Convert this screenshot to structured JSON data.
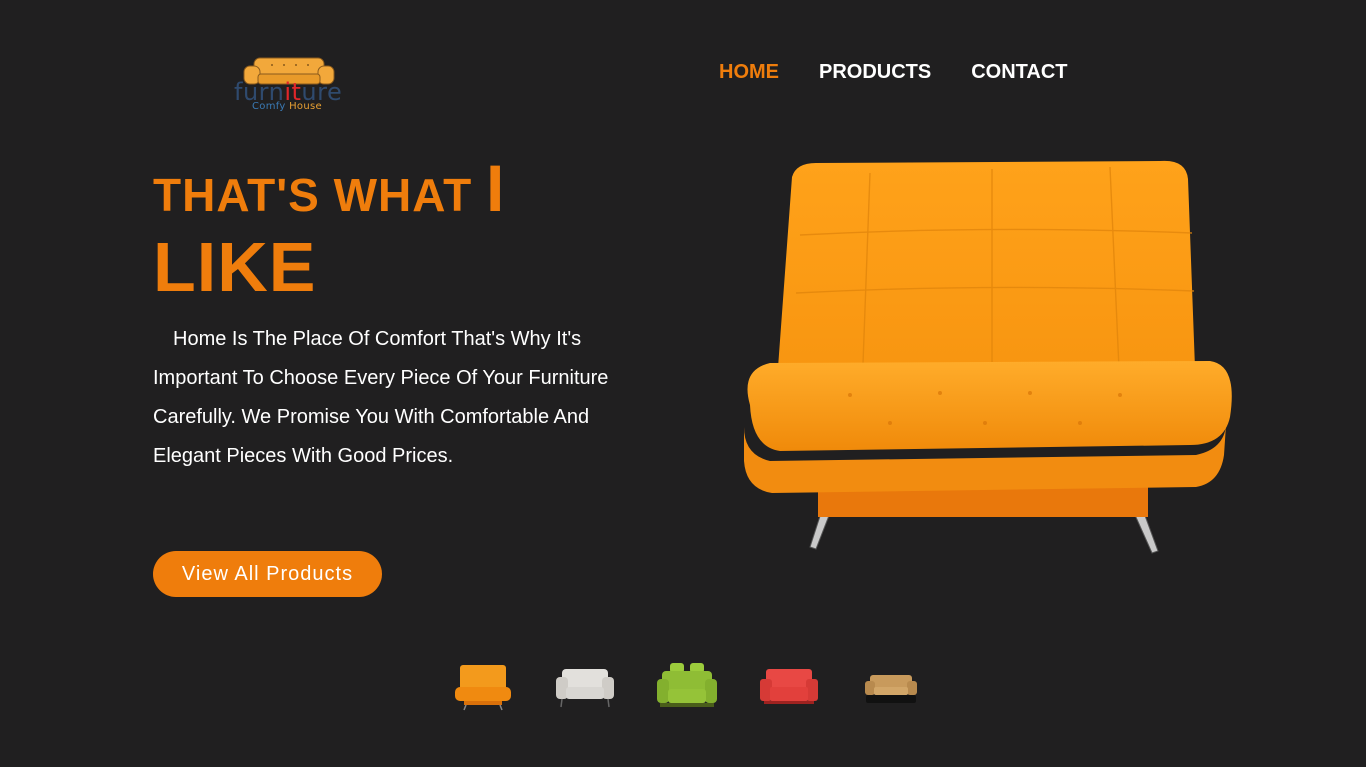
{
  "brand": {
    "logo_word_a": "furn",
    "logo_word_b": "it",
    "logo_word_c": "ure",
    "logo_sub_a": "Comfy ",
    "logo_sub_b": "House",
    "colors": {
      "logo_word": "#2f4a6e",
      "logo_highlight": "#e0262a",
      "logo_sofa": "#f2a83b"
    }
  },
  "nav": {
    "items": [
      {
        "label": "HOME",
        "active": true
      },
      {
        "label": "PRODUCTS",
        "active": false
      },
      {
        "label": "CONTACT",
        "active": false
      }
    ]
  },
  "hero": {
    "title_line1": "THAT'S WHAT ",
    "title_line1_big": "I",
    "title_line2": "LIKE",
    "description": "Home Is The Place Of Comfort That's Why It's Important To Choose Every Piece Of Your Furniture Carefully. We Promise You With Comfortable And Elegant Pieces With Good Prices.",
    "cta_label": "View All Products",
    "image": "orange-sofa-bed"
  },
  "thumbnails": [
    {
      "name": "orange-sofa-thumb",
      "color": "#f08a1a"
    },
    {
      "name": "grey-sofa-thumb",
      "color": "#d8d6d2"
    },
    {
      "name": "green-sofa-thumb",
      "color": "#8fbd35"
    },
    {
      "name": "red-sofa-thumb",
      "color": "#e2403c"
    },
    {
      "name": "tan-sofa-thumb",
      "color": "#c89a5c"
    }
  ],
  "colors": {
    "background": "#201f20",
    "accent": "#ef7d0c",
    "text": "#ffffff"
  }
}
